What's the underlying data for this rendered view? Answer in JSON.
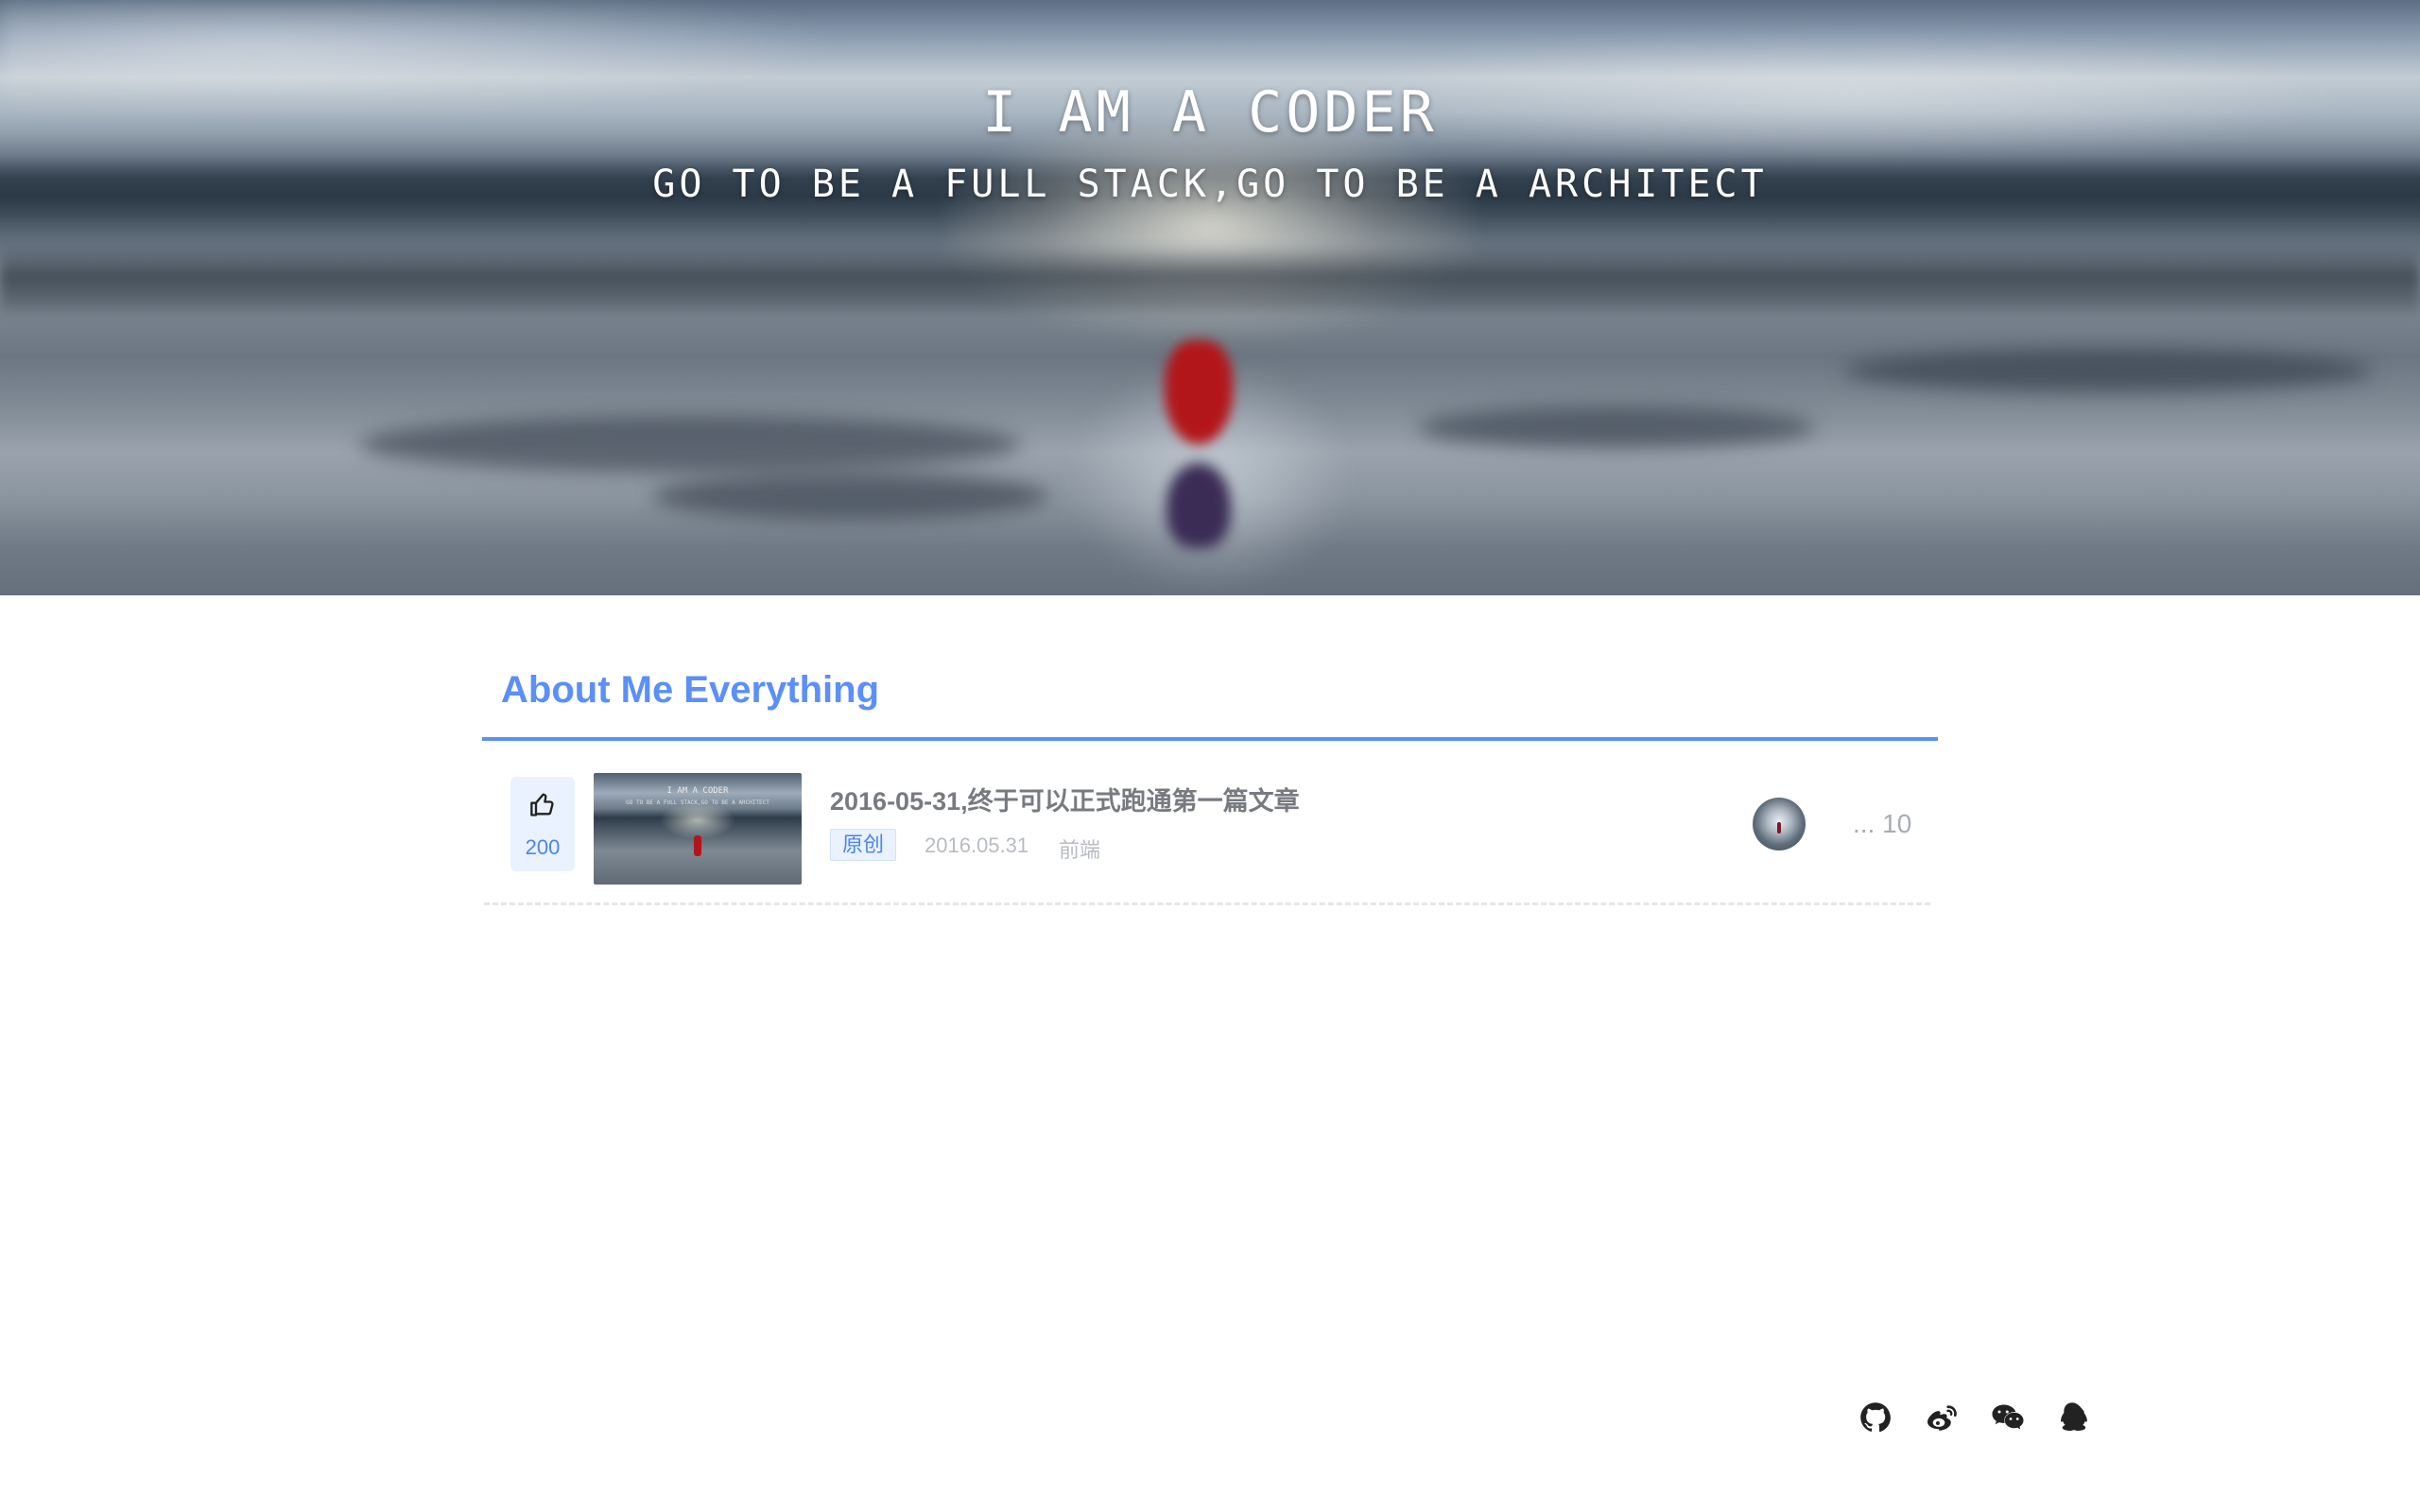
{
  "hero": {
    "title": "I AM A CODER",
    "subtitle": "GO TO BE A FULL STACK,GO TO BE A ARCHITECT"
  },
  "section": {
    "title": "About Me Everything"
  },
  "articles": [
    {
      "likes": "200",
      "title": "2016-05-31,终于可以正式跑通第一篇文章",
      "tag": "原创",
      "date": "2016.05.31",
      "category": "前端",
      "more": "... 10"
    }
  ],
  "footer": {
    "icons": [
      "github-icon",
      "weibo-icon",
      "wechat-icon",
      "qq-icon"
    ]
  },
  "colors": {
    "accent": "#5b8ff9",
    "tag_bg": "#eaf2ff",
    "muted_text": "#b8bcc2",
    "title_text": "#777b80"
  }
}
